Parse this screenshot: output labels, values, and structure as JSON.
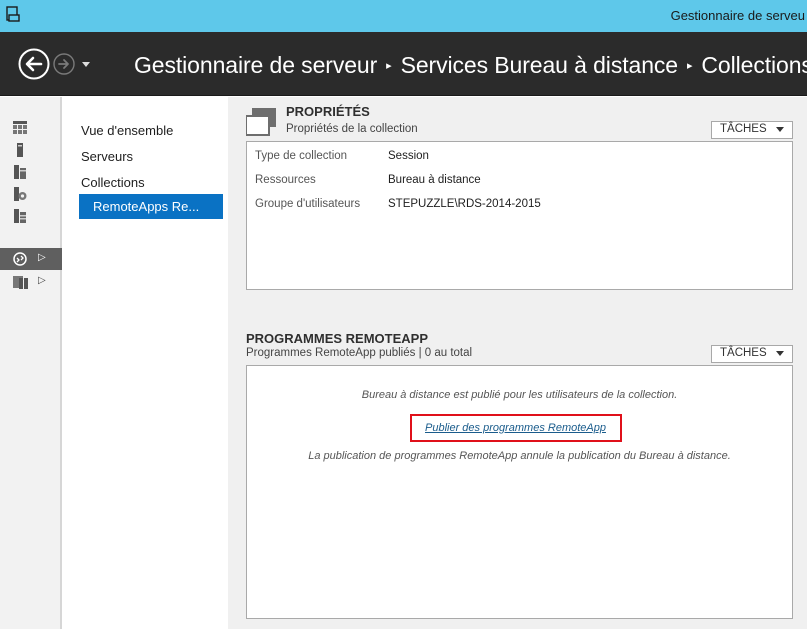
{
  "window": {
    "title": "Gestionnaire de serveu"
  },
  "nav": {
    "breadcrumb": [
      "Gestionnaire de serveur",
      "Services Bureau à distance",
      "Collections"
    ],
    "separator": "▸"
  },
  "rail": {
    "items": [
      {
        "icon": "dashboard-icon"
      },
      {
        "icon": "local-server-icon"
      },
      {
        "icon": "all-servers-icon"
      },
      {
        "icon": "file-storage-icon"
      },
      {
        "icon": "iis-icon"
      },
      {
        "icon": "remote-desktop-services-icon",
        "active": true,
        "arrow": "▷"
      },
      {
        "icon": "server-group-icon",
        "arrow": "▷"
      }
    ]
  },
  "subnav": {
    "items": [
      "Vue d'ensemble",
      "Serveurs",
      "Collections",
      "RemoteApps Re..."
    ],
    "selected_index": 3
  },
  "properties": {
    "title": "PROPRIÉTÉS",
    "subtitle": "Propriétés de la collection",
    "tasks_label": "TÂCHES",
    "rows": [
      {
        "label": "Type de collection",
        "value": "Session"
      },
      {
        "label": "Ressources",
        "value": "Bureau à distance"
      },
      {
        "label": "Groupe d'utilisateurs",
        "value": "STEPUZZLE\\RDS-2014-2015"
      }
    ]
  },
  "remoteapp": {
    "title": "PROGRAMMES REMOTEAPP",
    "subtitle": "Programmes RemoteApp publiés | 0 au total",
    "tasks_label": "TÂCHES",
    "info_text": "Bureau à distance est publié pour les utilisateurs de la collection.",
    "publish_link": "Publier des programmes RemoteApp",
    "note_text": "La publication de programmes RemoteApp annule la publication du Bureau à distance."
  },
  "colors": {
    "titlebar": "#5ec8ea",
    "navbar": "#2b2b2b",
    "selection": "#0a72c4",
    "highlight_border": "#e0101a",
    "link": "#1a5c8c"
  }
}
